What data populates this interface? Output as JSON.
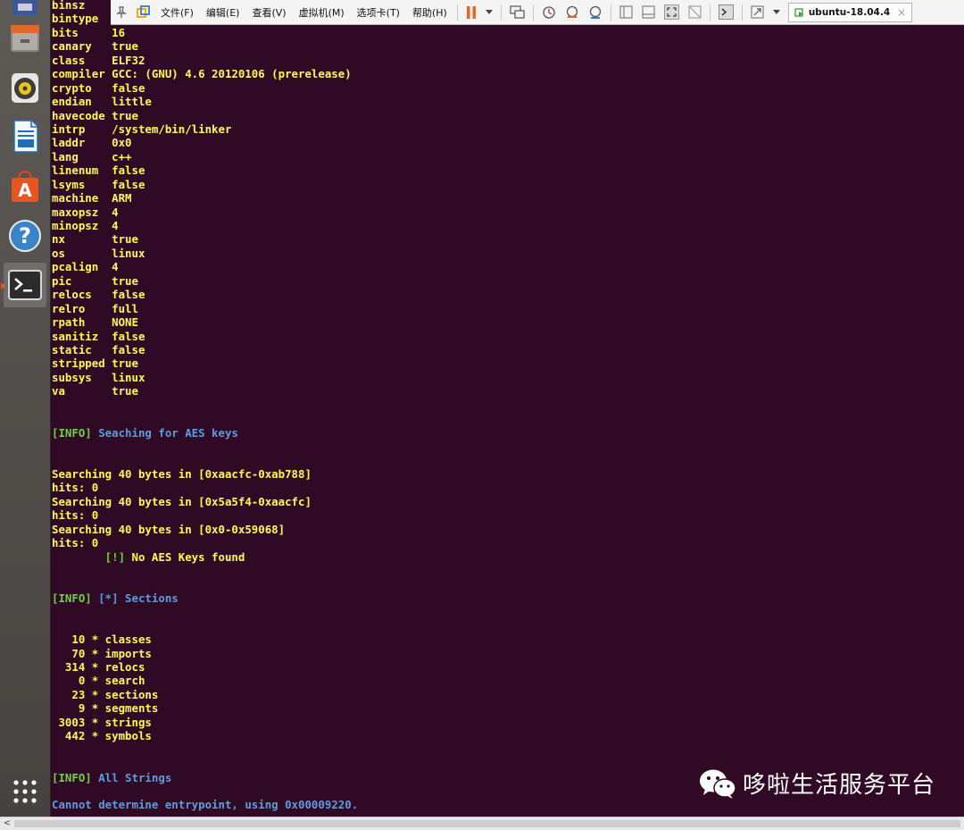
{
  "toolbar": {
    "menus": {
      "file": "文件(F)",
      "edit": "编辑(E)",
      "view": "查看(V)",
      "vm": "虚拟机(M)",
      "tabs": "选项卡(T)",
      "help": "帮助(H)"
    },
    "vm_tab": {
      "label": "ubuntu-18.04.4",
      "close": "×"
    }
  },
  "launcher": {
    "items": [
      "files-icon",
      "rhythmbox-icon",
      "writer-icon",
      "software-center-icon",
      "help-icon",
      "terminal-icon",
      "show-apps-icon"
    ]
  },
  "terminal": {
    "lines": [
      {
        "text": "binsz",
        "cls": "y"
      },
      {
        "text": "bintype",
        "cls": "y"
      },
      {
        "text": "bits     16",
        "cls": "y"
      },
      {
        "text": "canary   true",
        "cls": "y"
      },
      {
        "text": "class    ELF32",
        "cls": "y"
      },
      {
        "text": "compiler GCC: (GNU) 4.6 20120106 (prerelease)",
        "cls": "y"
      },
      {
        "text": "crypto   false",
        "cls": "y"
      },
      {
        "text": "endian   little",
        "cls": "y"
      },
      {
        "text": "havecode true",
        "cls": "y"
      },
      {
        "text": "intrp    /system/bin/linker",
        "cls": "y"
      },
      {
        "text": "laddr    0x0",
        "cls": "y"
      },
      {
        "text": "lang     c++",
        "cls": "y"
      },
      {
        "text": "linenum  false",
        "cls": "y"
      },
      {
        "text": "lsyms    false",
        "cls": "y"
      },
      {
        "text": "machine  ARM",
        "cls": "y"
      },
      {
        "text": "maxopsz  4",
        "cls": "y"
      },
      {
        "text": "minopsz  4",
        "cls": "y"
      },
      {
        "text": "nx       true",
        "cls": "y"
      },
      {
        "text": "os       linux",
        "cls": "y"
      },
      {
        "text": "pcalign  4",
        "cls": "y"
      },
      {
        "text": "pic      true",
        "cls": "y"
      },
      {
        "text": "relocs   false",
        "cls": "y"
      },
      {
        "text": "relro    full",
        "cls": "y"
      },
      {
        "text": "rpath    NONE",
        "cls": "y"
      },
      {
        "text": "sanitiz  false",
        "cls": "y"
      },
      {
        "text": "static   false",
        "cls": "y"
      },
      {
        "text": "stripped true",
        "cls": "y"
      },
      {
        "text": "subsys   linux",
        "cls": "y"
      },
      {
        "text": "va       true",
        "cls": "y"
      },
      {
        "text": "",
        "cls": "y"
      },
      {
        "text": "",
        "cls": "y"
      },
      {
        "segs": [
          {
            "text": "[INFO] ",
            "cls": "g"
          },
          {
            "text": "Seaching for AES keys",
            "cls": "b"
          }
        ]
      },
      {
        "text": "",
        "cls": "y"
      },
      {
        "text": "",
        "cls": "y"
      },
      {
        "text": "Searching 40 bytes in [0xaacfc-0xab788]",
        "cls": "y"
      },
      {
        "text": "hits: 0",
        "cls": "y"
      },
      {
        "text": "Searching 40 bytes in [0x5a5f4-0xaacfc]",
        "cls": "y"
      },
      {
        "text": "hits: 0",
        "cls": "y"
      },
      {
        "text": "Searching 40 bytes in [0x0-0x59068]",
        "cls": "y"
      },
      {
        "text": "hits: 0",
        "cls": "y"
      },
      {
        "segs": [
          {
            "text": "        [!] ",
            "cls": "g"
          },
          {
            "text": "No AES Keys found",
            "cls": "y"
          }
        ]
      },
      {
        "text": "",
        "cls": "y"
      },
      {
        "text": "",
        "cls": "y"
      },
      {
        "segs": [
          {
            "text": "[INFO] ",
            "cls": "g"
          },
          {
            "text": "[*] Sections",
            "cls": "b"
          }
        ]
      },
      {
        "text": "",
        "cls": "y"
      },
      {
        "text": "",
        "cls": "y"
      },
      {
        "text": "   10 * classes",
        "cls": "y"
      },
      {
        "text": "   70 * imports",
        "cls": "y"
      },
      {
        "text": "  314 * relocs",
        "cls": "y"
      },
      {
        "text": "    0 * search",
        "cls": "y"
      },
      {
        "text": "   23 * sections",
        "cls": "y"
      },
      {
        "text": "    9 * segments",
        "cls": "y"
      },
      {
        "text": " 3003 * strings",
        "cls": "y"
      },
      {
        "text": "  442 * symbols",
        "cls": "y"
      },
      {
        "text": "",
        "cls": "y"
      },
      {
        "text": "",
        "cls": "y"
      },
      {
        "segs": [
          {
            "text": "[INFO] ",
            "cls": "g"
          },
          {
            "text": "All Strings",
            "cls": "b"
          }
        ]
      },
      {
        "text": "",
        "cls": "y"
      },
      {
        "text": "Cannot determine entrypoint, using 0x00009220.",
        "cls": "b"
      }
    ]
  },
  "watermark": {
    "text": "哆啦生活服务平台"
  },
  "scrollbar": {
    "left_arrow": "<"
  }
}
